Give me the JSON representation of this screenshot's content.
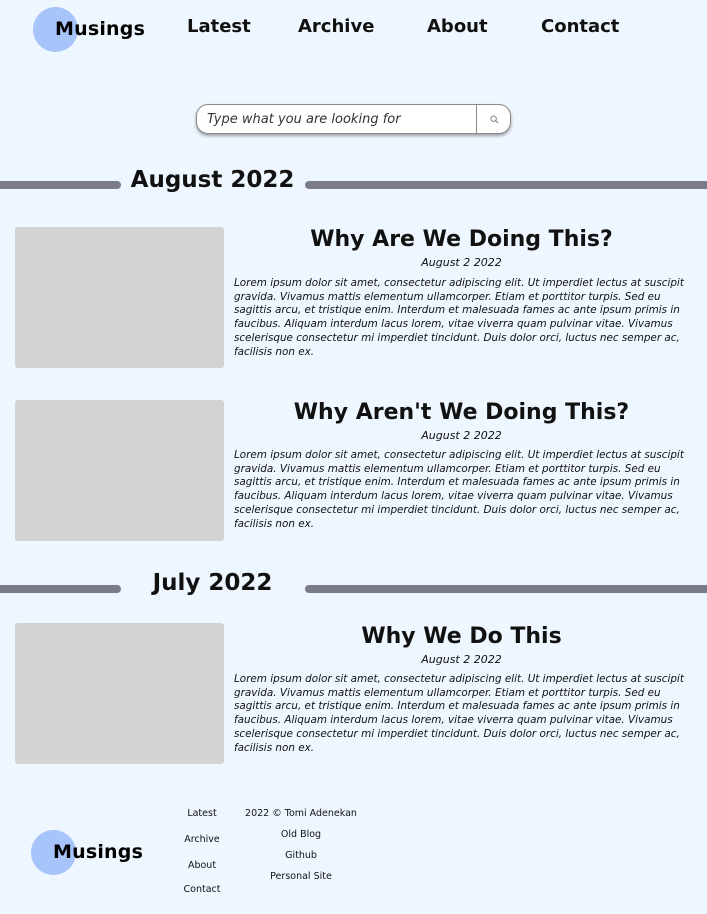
{
  "header": {
    "logo": "Musings",
    "nav": [
      "Latest",
      "Archive",
      "About",
      "Contact"
    ]
  },
  "search": {
    "placeholder": "Type what you are looking for",
    "icon": "search-icon"
  },
  "months": [
    {
      "label": "August 2022",
      "posts": [
        {
          "title": "Why Are We Doing This?",
          "date": "August 2 2022",
          "excerpt": "Lorem ipsum dolor sit amet, consectetur adipiscing elit. Ut imperdiet lectus at suscipit gravida. Vivamus mattis elementum ullamcorper. Etiam et porttitor turpis. Sed eu sagittis arcu, et tristique enim. Interdum et malesuada fames ac ante ipsum primis in faucibus. Aliquam interdum lacus lorem, vitae viverra quam pulvinar vitae. Vivamus scelerisque consectetur mi imperdiet tincidunt. Duis dolor orci, luctus nec semper ac, facilisis non ex."
        },
        {
          "title": "Why Aren't We Doing This?",
          "date": "August 2 2022",
          "excerpt": "Lorem ipsum dolor sit amet, consectetur adipiscing elit. Ut imperdiet lectus at suscipit gravida. Vivamus mattis elementum ullamcorper. Etiam et porttitor turpis. Sed eu sagittis arcu, et tristique enim. Interdum et malesuada fames ac ante ipsum primis in faucibus. Aliquam interdum lacus lorem, vitae viverra quam pulvinar vitae. Vivamus scelerisque consectetur mi imperdiet tincidunt. Duis dolor orci, luctus nec semper ac, facilisis non ex."
        }
      ]
    },
    {
      "label": "July 2022",
      "posts": [
        {
          "title": "Why We Do This",
          "date": "August 2 2022",
          "excerpt": "Lorem ipsum dolor sit amet, consectetur adipiscing elit. Ut imperdiet lectus at suscipit gravida. Vivamus mattis elementum ullamcorper. Etiam et porttitor turpis. Sed eu sagittis arcu, et tristique enim. Interdum et malesuada fames ac ante ipsum primis in faucibus. Aliquam interdum lacus lorem, vitae viverra quam pulvinar vitae. Vivamus scelerisque consectetur mi imperdiet tincidunt. Duis dolor orci, luctus nec semper ac, facilisis non ex."
        }
      ]
    }
  ],
  "footer": {
    "logo": "Musings",
    "nav": [
      "Latest",
      "Archive",
      "About",
      "Contact"
    ],
    "copyright": "2022 © Tomi Adenekan",
    "links": [
      "Old Blog",
      "Github",
      "Personal Site"
    ]
  },
  "colors": {
    "background": "#eef6ff",
    "logo_circle": "#a7c4fb",
    "divider": "#7a7d87",
    "thumbnail": "#d3d3d3"
  }
}
